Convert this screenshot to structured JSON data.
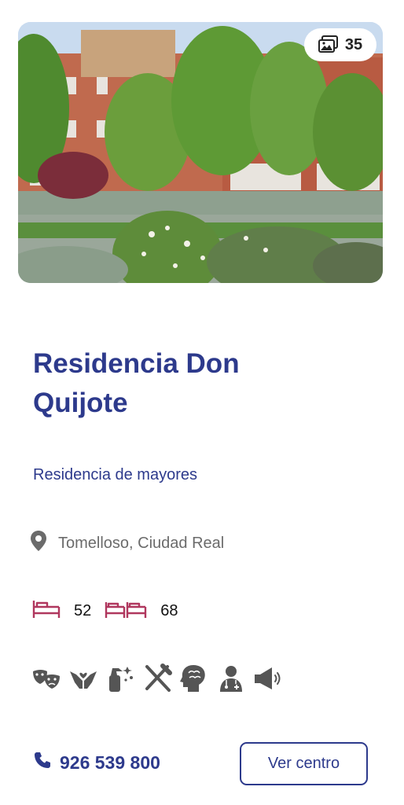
{
  "gallery": {
    "photo_count": "35"
  },
  "center": {
    "name": "Residencia Don Quijote",
    "type": "Residencia de mayores",
    "location": "Tomelloso, Ciudad Real"
  },
  "capacity": {
    "single_beds": "52",
    "double_beds": "68",
    "icons": [
      "single-bed-icon",
      "double-bed-icon"
    ],
    "icon_color": "#b0375e"
  },
  "services": [
    "theater-masks-icon",
    "caring-hands-icon",
    "cleaning-spray-icon",
    "fork-knife-icon",
    "brain-head-icon",
    "doctor-icon",
    "megaphone-icon"
  ],
  "contact": {
    "phone": "926 539 800"
  },
  "actions": {
    "view_center": "Ver centro"
  },
  "colors": {
    "primary": "#2d3a8c",
    "accent": "#b0375e",
    "muted": "#6b6b6b"
  }
}
